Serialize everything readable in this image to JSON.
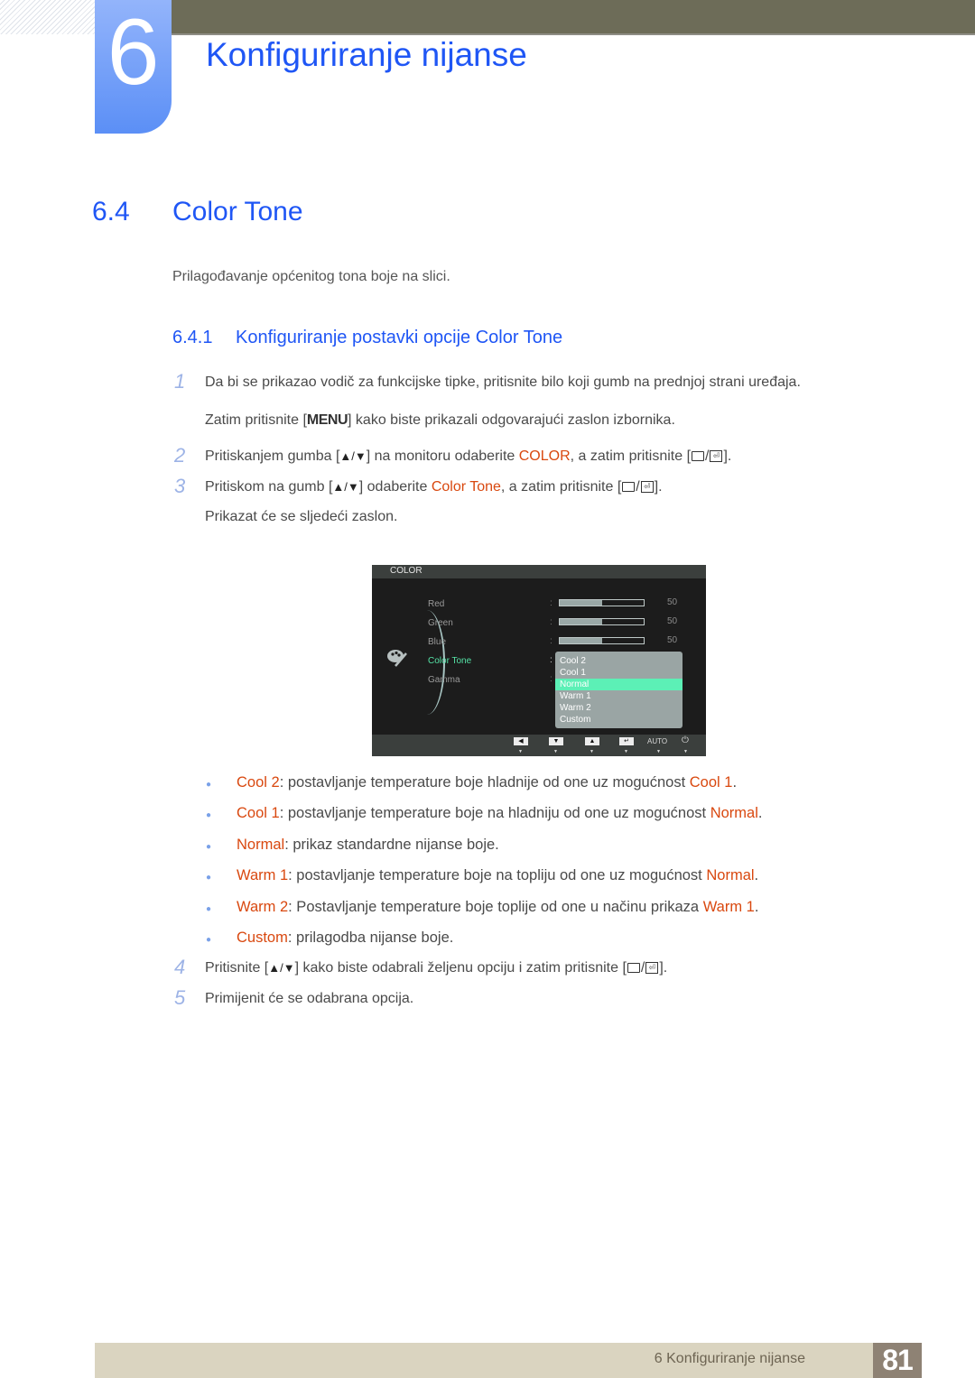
{
  "header": {
    "chapter_number": "6",
    "chapter_title": "Konfiguriranje nijanse"
  },
  "section": {
    "number": "6.4",
    "title": "Color Tone",
    "intro": "Prilagođavanje općenitog tona boje na slici."
  },
  "subsection": {
    "number": "6.4.1",
    "title": "Konfiguriranje postavki opcije Color Tone"
  },
  "steps": [
    {
      "num": "1",
      "text": "Da bi se prikazao vodič za funkcijske tipke, pritisnite bilo koji gumb na prednjoj strani uređaja."
    },
    {
      "num": "",
      "pre": "Zatim pritisnite [",
      "key": "MENU",
      "post": "] kako biste prikazali odgovarajući zaslon izbornika."
    },
    {
      "num": "2",
      "pre": "Pritiskanjem gumba [",
      "arrows": "▲/▼",
      "mid": "] na monitoru odaberite ",
      "hl": "COLOR",
      "post": ", a zatim pritisnite [",
      "end": "]."
    },
    {
      "num": "3",
      "pre": "Pritiskom na gumb [",
      "arrows": "▲/▼",
      "mid": "] odaberite ",
      "hl": "Color Tone",
      "post": ", a zatim pritisnite [",
      "end": "]."
    },
    {
      "num": "",
      "text": "Prikazat će se sljedeći zaslon."
    },
    {
      "num": "4",
      "pre": "Pritisnite [",
      "arrows": "▲/▼",
      "mid": "] kako biste odabrali željenu opciju i zatim pritisnite [",
      "end": "]."
    },
    {
      "num": "5",
      "text": "Primijenit će se odabrana opcija."
    }
  ],
  "osd": {
    "title": "COLOR",
    "menu_items": [
      {
        "label": "Red",
        "value": "50",
        "level": 0.5
      },
      {
        "label": "Green",
        "value": "50",
        "level": 0.5
      },
      {
        "label": "Blue",
        "value": "50",
        "level": 0.5
      },
      {
        "label": "Color Tone",
        "active": true
      },
      {
        "label": "Gamma"
      }
    ],
    "colon": ":",
    "tone_options": [
      "Cool 2",
      "Cool 1",
      "Normal",
      "Warm 1",
      "Warm 2",
      "Custom"
    ],
    "selected_option": "Normal",
    "footer_buttons": [
      "left-arrow",
      "down-arrow",
      "up-arrow",
      "enter",
      "AUTO",
      "power"
    ],
    "auto_label": "AUTO"
  },
  "options": [
    {
      "name": "Cool 2",
      "desc": ": postavljanje temperature boje hladnije od one uz mogućnost ",
      "ref": "Cool 1",
      "end": "."
    },
    {
      "name": "Cool 1",
      "desc": ": postavljanje temperature boje na hladniju od one uz mogućnost ",
      "ref": "Normal",
      "end": "."
    },
    {
      "name": "Normal",
      "desc": ": prikaz standardne nijanse boje.",
      "ref": "",
      "end": ""
    },
    {
      "name": "Warm 1",
      "desc": ": postavljanje temperature boje na topliju od one uz mogućnost ",
      "ref": "Normal",
      "end": "."
    },
    {
      "name": "Warm 2",
      "desc": ": Postavljanje temperature boje toplije od one u načinu prikaza ",
      "ref": "Warm 1",
      "end": "."
    },
    {
      "name": "Custom",
      "desc": ": prilagodba nijanse boje.",
      "ref": "",
      "end": ""
    }
  ],
  "footer": {
    "chapter_label": "6 Konfiguriranje nijanse",
    "page_number": "81"
  },
  "colors": {
    "heading_blue": "#1f56f5",
    "highlight_orange": "#d9480f",
    "osd_selected": "#5cf0b6",
    "osd_active_text": "#55e3a6"
  }
}
